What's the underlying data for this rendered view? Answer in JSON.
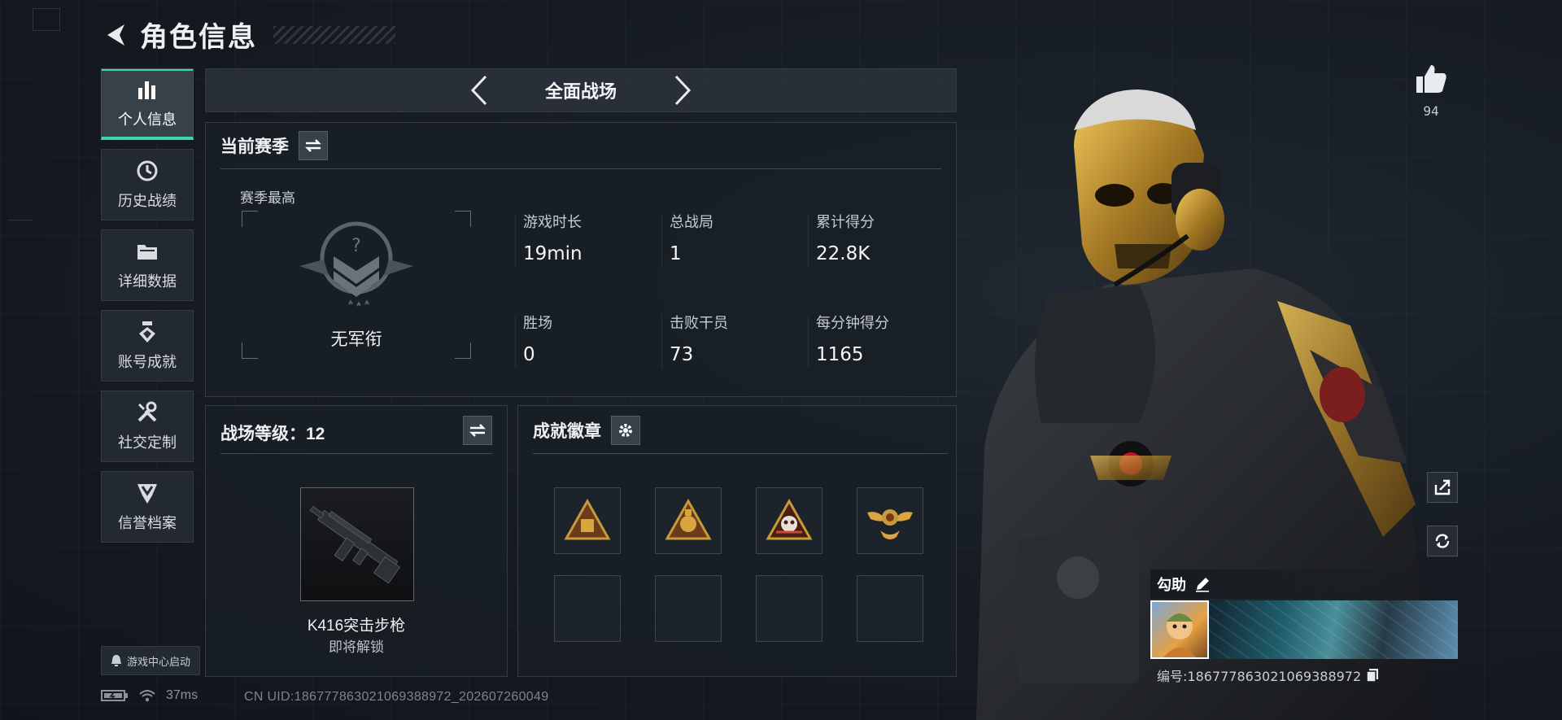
{
  "header": {
    "title": "角色信息"
  },
  "sidebar": {
    "items": [
      {
        "label": "个人信息",
        "icon": "bar-chart-icon",
        "active": true
      },
      {
        "label": "历史战绩",
        "icon": "clock-icon",
        "active": false
      },
      {
        "label": "详细数据",
        "icon": "folder-icon",
        "active": false
      },
      {
        "label": "账号成就",
        "icon": "achievement-icon",
        "active": false
      },
      {
        "label": "社交定制",
        "icon": "tools-icon",
        "active": false
      },
      {
        "label": "信誉档案",
        "icon": "shield-badge-icon",
        "active": false
      }
    ],
    "launch_badge": "游戏中心启动"
  },
  "mode": {
    "label": "全面战场"
  },
  "season": {
    "title": "当前赛季",
    "best_label": "赛季最高",
    "rank_name": "无军衔",
    "stats": [
      {
        "label": "游戏时长",
        "value": "19min"
      },
      {
        "label": "总战局",
        "value": "1"
      },
      {
        "label": "累计得分",
        "value": "22.8K"
      },
      {
        "label": "胜场",
        "value": "0"
      },
      {
        "label": "击败干员",
        "value": "73"
      },
      {
        "label": "每分钟得分",
        "value": "1165"
      }
    ]
  },
  "level": {
    "title": "战场等级：12",
    "weapon_name": "K416突击步枪",
    "weapon_status": "即将解锁"
  },
  "achievements": {
    "title": "成就徽章",
    "badges_filled": 4,
    "badges_total": 8
  },
  "profile": {
    "likes": "94",
    "name": "勾助",
    "id_text": "编号:1867778630210693889​72"
  },
  "status": {
    "ping": "37ms",
    "uid": "CN UID:1867778630210693889​72_202607260049"
  },
  "colors": {
    "accent": "#3ed6a8",
    "gold": "#c79a3a",
    "background": "#141920"
  }
}
